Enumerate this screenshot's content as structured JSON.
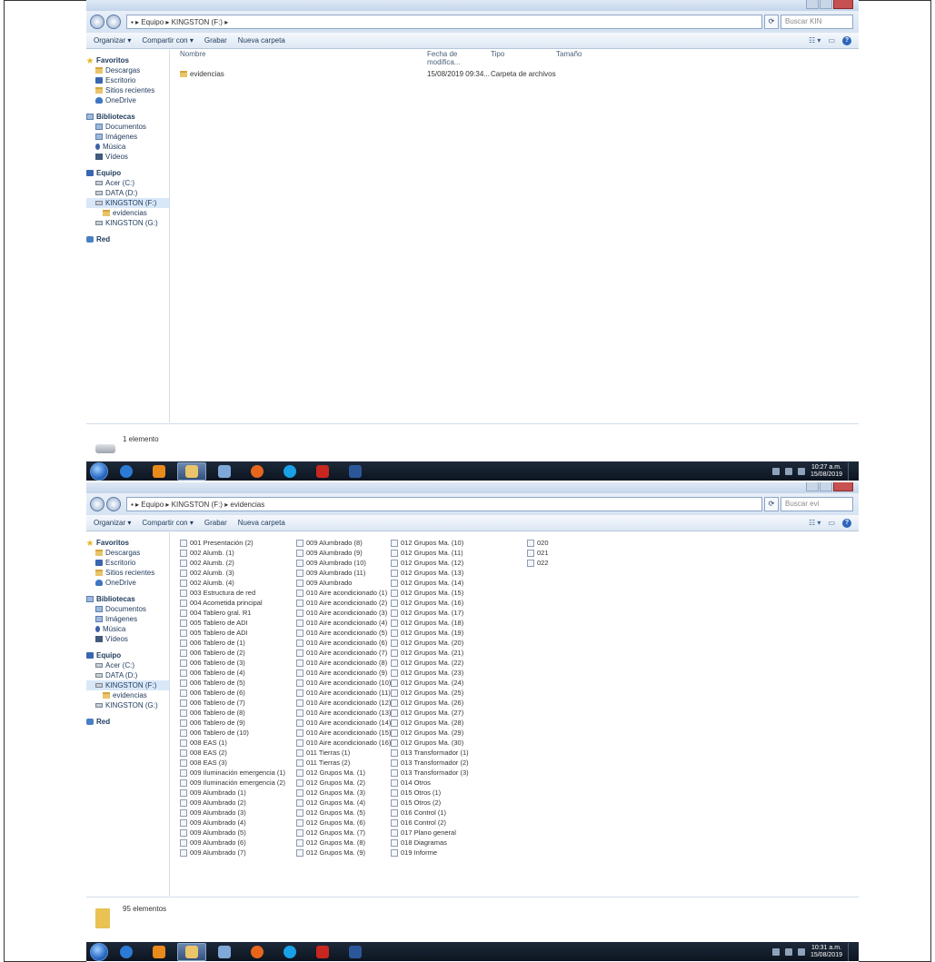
{
  "shot1": {
    "address": "▪ ▸ Equipo ▸ KINGSTON (F:) ▸",
    "search_placeholder": "Buscar KIN",
    "toolbar": [
      "Organizar ▾",
      "Compartir con ▾",
      "Grabar",
      "Nueva carpeta"
    ],
    "columns": [
      "Nombre",
      "Fecha de modifica...",
      "Tipo",
      "Tamaño"
    ],
    "rows": [
      {
        "name": "evidencias",
        "date": "15/08/2019 09:34...",
        "type": "Carpeta de archivos",
        "size": ""
      }
    ],
    "status": "1 elemento",
    "clock": {
      "time": "10:27 a.m.",
      "date": "15/08/2019"
    }
  },
  "shot2": {
    "address": "▪ ▸ Equipo ▸ KINGSTON (F:) ▸ evidencias",
    "search_placeholder": "Buscar evi",
    "toolbar": [
      "Organizar ▾",
      "Compartir con ▾",
      "Grabar",
      "Nueva carpeta"
    ],
    "status": "95 elementos",
    "clock": {
      "time": "10:31 a.m.",
      "date": "15/08/2019"
    },
    "file_columns": [
      [
        "001 Presentación (2)",
        "002 Alumb. (1)",
        "002 Alumb. (2)",
        "002 Alumb. (3)",
        "002 Alumb. (4)",
        "003 Estructura de red",
        "004 Acometida principal",
        "004 Tablero gral. R1",
        "005 Tablero de ADI",
        "005 Tablero de ADI",
        "006 Tablero de (1)",
        "006 Tablero de (2)",
        "006 Tablero de (3)",
        "006 Tablero de (4)",
        "006 Tablero de (5)",
        "006 Tablero de (6)",
        "006 Tablero de (7)",
        "006 Tablero de (8)",
        "006 Tablero de (9)",
        "006 Tablero de (10)",
        "008 EAS (1)",
        "008 EAS (2)",
        "008 EAS (3)",
        "009 Iluminación emergencia (1)",
        "009 Iluminación emergencia (2)",
        "009 Alumbrado (1)",
        "009 Alumbrado (2)",
        "009 Alumbrado (3)",
        "009 Alumbrado (4)",
        "009 Alumbrado (5)",
        "009 Alumbrado (6)",
        "009 Alumbrado (7)"
      ],
      [
        "009 Alumbrado (8)",
        "009 Alumbrado (9)",
        "009 Alumbrado (10)",
        "009 Alumbrado (11)",
        "009 Alumbrado",
        "010 Aire acondicionado (1)",
        "010 Aire acondicionado (2)",
        "010 Aire acondicionado (3)",
        "010 Aire acondicionado (4)",
        "010 Aire acondicionado (5)",
        "010 Aire acondicionado (6)",
        "010 Aire acondicionado (7)",
        "010 Aire acondicionado (8)",
        "010 Aire acondicionado (9)",
        "010 Aire acondicionado (10)",
        "010 Aire acondicionado (11)",
        "010 Aire acondicionado (12)",
        "010 Aire acondicionado (13)",
        "010 Aire acondicionado (14)",
        "010 Aire acondicionado (15)",
        "010 Aire acondicionado (16)",
        "011 Tierras (1)",
        "011 Tierras (2)",
        "012 Grupos Ma. (1)",
        "012 Grupos Ma. (2)",
        "012 Grupos Ma. (3)",
        "012 Grupos Ma. (4)",
        "012 Grupos Ma. (5)",
        "012 Grupos Ma. (6)",
        "012 Grupos Ma. (7)",
        "012 Grupos Ma. (8)",
        "012 Grupos Ma. (9)"
      ],
      [
        "012 Grupos Ma. (10)",
        "012 Grupos Ma. (11)",
        "012 Grupos Ma. (12)",
        "012 Grupos Ma. (13)",
        "012 Grupos Ma. (14)",
        "012 Grupos Ma. (15)",
        "012 Grupos Ma. (16)",
        "012 Grupos Ma. (17)",
        "012 Grupos Ma. (18)",
        "012 Grupos Ma. (19)",
        "012 Grupos Ma. (20)",
        "012 Grupos Ma. (21)",
        "012 Grupos Ma. (22)",
        "012 Grupos Ma. (23)",
        "012 Grupos Ma. (24)",
        "012 Grupos Ma. (25)",
        "012 Grupos Ma. (26)",
        "012 Grupos Ma. (27)",
        "012 Grupos Ma. (28)",
        "012 Grupos Ma. (29)",
        "012 Grupos Ma. (30)",
        "013 Transformador (1)",
        "013 Transformador (2)",
        "013 Transformador (3)",
        "014 Otros",
        "015 Otros (1)",
        "015 Otros (2)",
        "016 Control (1)",
        "016 Control (2)",
        "017 Plano general",
        "018 Diagramas",
        "019 Informe"
      ],
      [
        "020",
        "021",
        "022"
      ]
    ]
  },
  "nav": [
    {
      "label": "Favoritos",
      "level": "head",
      "icon": "star"
    },
    {
      "label": "Descargas",
      "level": "sub",
      "icon": "folder"
    },
    {
      "label": "Escritorio",
      "level": "sub",
      "icon": "comp"
    },
    {
      "label": "Sitios recientes",
      "level": "sub",
      "icon": "folder"
    },
    {
      "label": "OneDrive",
      "level": "sub",
      "icon": "cloud"
    },
    {
      "label": "Bibliotecas",
      "level": "head",
      "icon": "lib"
    },
    {
      "label": "Documentos",
      "level": "sub",
      "icon": "lib"
    },
    {
      "label": "Imágenes",
      "level": "sub",
      "icon": "lib"
    },
    {
      "label": "Música",
      "level": "sub",
      "icon": "music"
    },
    {
      "label": "Vídeos",
      "level": "sub",
      "icon": "video"
    },
    {
      "label": "Equipo",
      "level": "head",
      "icon": "comp"
    },
    {
      "label": "Acer (C:)",
      "level": "sub",
      "icon": "drive"
    },
    {
      "label": "DATA (D:)",
      "level": "sub",
      "icon": "drive"
    },
    {
      "label": "KINGSTON (F:)",
      "level": "sub",
      "icon": "drive",
      "selected": true
    },
    {
      "label": "evidencias",
      "level": "subsub",
      "icon": "folder"
    },
    {
      "label": "KINGSTON (G:)",
      "level": "sub",
      "icon": "drive"
    },
    {
      "label": "Red",
      "level": "head",
      "icon": "net"
    }
  ],
  "cmd_icons": [
    "view-options-icon",
    "preview-pane-icon",
    "help-icon"
  ],
  "taskbar_icons": [
    "ie-icon",
    "media-player-icon",
    "explorer-icon",
    "paint-icon",
    "firefox-icon",
    "skype-icon",
    "pdf-icon",
    "word-icon"
  ]
}
